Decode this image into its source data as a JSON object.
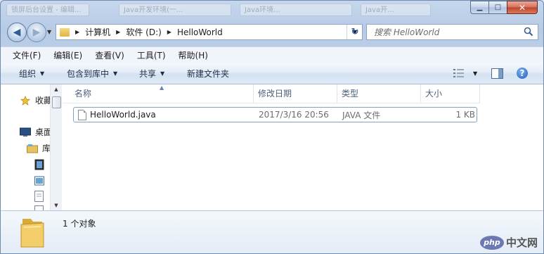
{
  "window": {
    "ghost_tabs": [
      "锁屏后台设置 - 编辑...",
      "Java开发环境(一...",
      "Java环境...",
      "Java开..."
    ],
    "minimize_glyph": "▁",
    "maximize_glyph": "□",
    "close_glyph": "✕"
  },
  "address_bar": {
    "breadcrumbs": [
      "计算机",
      "软件 (D:)",
      "HelloWorld"
    ],
    "back_glyph": "◀",
    "forward_glyph": "▶",
    "refresh_glyph": "↻"
  },
  "search": {
    "placeholder": "搜索 HelloWorld"
  },
  "menu": [
    "文件(F)",
    "编辑(E)",
    "查看(V)",
    "工具(T)",
    "帮助(H)"
  ],
  "toolbar": {
    "organize": "组织",
    "include_in_library": "包含到库中",
    "share": "共享",
    "new_folder": "新建文件夹",
    "help_glyph": "?"
  },
  "nav_pane": {
    "favorites": "收藏夹",
    "desktop": "桌面",
    "libraries": "库"
  },
  "columns": [
    "名称",
    "修改日期",
    "类型",
    "大小"
  ],
  "files": [
    {
      "name": "HelloWorld.java",
      "modified": "2017/3/16 20:56",
      "type": "JAVA 文件",
      "size": "1 KB"
    }
  ],
  "status": {
    "item_count": "1 个对象"
  },
  "watermark": {
    "logo": "php",
    "site": "中文网"
  }
}
